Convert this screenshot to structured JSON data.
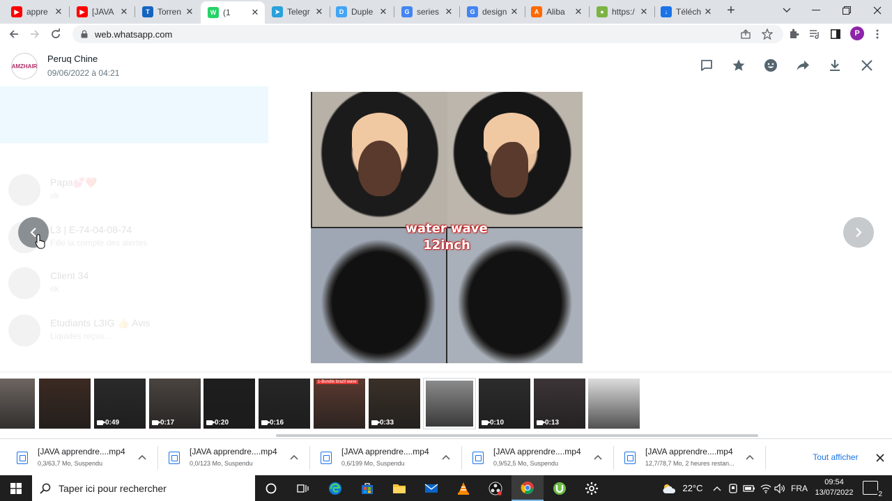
{
  "browser": {
    "tabs": [
      {
        "title": "appre",
        "icon": "youtube-icon",
        "color": "#ff0000"
      },
      {
        "title": "[JAVA",
        "icon": "youtube-icon",
        "color": "#ff0000"
      },
      {
        "title": "Torren",
        "icon": "torrent9-icon",
        "color": "#1565c0"
      },
      {
        "title": "(1",
        "icon": "whatsapp-icon",
        "color": "#25d366"
      },
      {
        "title": "Telegr",
        "icon": "telegram-icon",
        "color": "#2aa1da"
      },
      {
        "title": "Duple",
        "icon": "duplex-icon",
        "color": "#42a5f5"
      },
      {
        "title": "series",
        "icon": "google-icon",
        "color": "#4285f4"
      },
      {
        "title": "design",
        "icon": "google-icon",
        "color": "#4285f4"
      },
      {
        "title": "Aliba",
        "icon": "alibaba-icon",
        "color": "#ff6a00"
      },
      {
        "title": "https:/",
        "icon": "leaf-icon",
        "color": "#7cb342"
      },
      {
        "title": "Téléch",
        "icon": "download-icon",
        "color": "#1a73e8"
      }
    ],
    "active_tab_index": 3,
    "url": "web.whatsapp.com",
    "profile_initial": "P",
    "profile_color": "#8e24aa"
  },
  "viewer": {
    "sender_name": "Peruq Chine",
    "timestamp": "09/06/2022 à 04:21",
    "avatar_text": "AMZHAIR",
    "actions": [
      "reply-icon",
      "star-icon",
      "emoji-icon",
      "forward-icon",
      "download-icon",
      "close-icon"
    ],
    "media_caption_line1": "water wave",
    "media_caption_line2": "12inch",
    "background_chats": [
      {
        "name": "Papa💕❤️",
        "preview": "ok"
      },
      {
        "name": "L3 | E-74-04-08-74",
        "preview": "Fille la compte des alertes"
      },
      {
        "name": "Client 34",
        "preview": "ok"
      },
      {
        "name": "Etudiants L3IG 👍 Avis",
        "preview": "Liquides reçus..."
      }
    ],
    "thumbnails": [
      {
        "label": "",
        "video": false,
        "color": "#6d6560"
      },
      {
        "label": "",
        "video": false,
        "color": "#3b2a22"
      },
      {
        "label": "0:49",
        "video": true,
        "color": "#2a2a2a"
      },
      {
        "label": "0:17",
        "video": true,
        "color": "#4a4440"
      },
      {
        "label": "0:20",
        "video": true,
        "color": "#1e1e1e"
      },
      {
        "label": "0:16",
        "video": true,
        "color": "#262626"
      },
      {
        "label": "",
        "video": false,
        "color": "#5a3a30",
        "tag": "1-Bundle brazil wave"
      },
      {
        "label": "0:33",
        "video": true,
        "color": "#3a3028"
      },
      {
        "label": "",
        "video": false,
        "color": "#8a8a8a",
        "selected": true
      },
      {
        "label": "0:10",
        "video": true,
        "color": "#2c2c2c"
      },
      {
        "label": "0:13",
        "video": true,
        "color": "#3c3436"
      },
      {
        "label": "",
        "video": false,
        "color": "#dcdcdc"
      }
    ]
  },
  "downloads": {
    "items": [
      {
        "name": "[JAVA apprendre....mp4",
        "status": "0,3/63,7 Mo, Suspendu"
      },
      {
        "name": "[JAVA apprendre....mp4",
        "status": "0,0/123 Mo, Suspendu"
      },
      {
        "name": "[JAVA apprendre....mp4",
        "status": "0,6/199 Mo, Suspendu"
      },
      {
        "name": "[JAVA apprendre....mp4",
        "status": "0,9/52,5 Mo, Suspendu"
      },
      {
        "name": "[JAVA apprendre....mp4",
        "status": "12,7/78,7 Mo, 2 heures restan..."
      }
    ],
    "show_all": "Tout afficher"
  },
  "taskbar": {
    "search_placeholder": "Taper ici pour rechercher",
    "weather": "22°C",
    "language": "FRA",
    "time": "09:54",
    "date": "13/07/2022",
    "notification_count": "2"
  },
  "colors": {
    "whatsapp_icon": "#54656f",
    "chrome_accent": "#1a73e8",
    "caption_outline": "#c62828"
  }
}
